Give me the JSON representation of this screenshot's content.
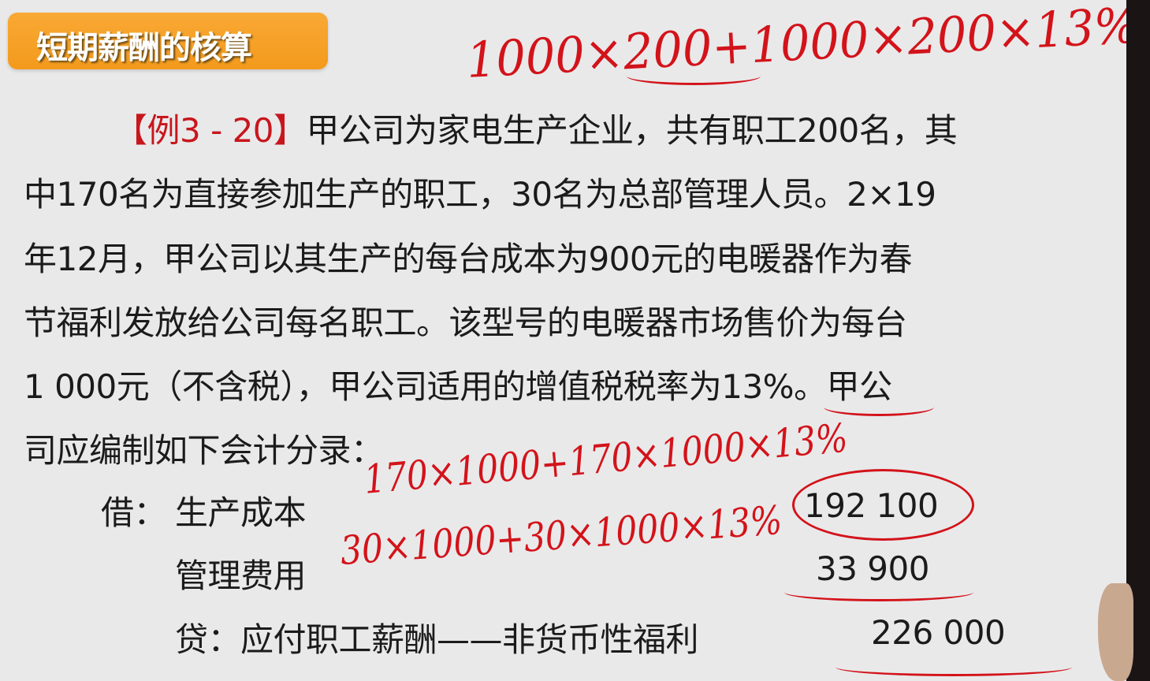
{
  "title": "短期薪酬的核算",
  "example_tag": "【例3 - 20】",
  "paragraph": [
    "甲公司为家电生产企业，共有职工200名，其",
    "中170名为直接参加生产的职工，30名为总部管理人员。2×19",
    "年12月，甲公司以其生产的每台成本为900元的电暖器作为春",
    "节福利发放给公司每名职工。该型号的电暖器市场售价为每台",
    "1 000元（不含税），甲公司适用的增值税税率为13%。甲公",
    "司应编制如下会计分录："
  ],
  "entries": [
    {
      "side": "借：",
      "account": "生产成本",
      "amount": "192 100"
    },
    {
      "side": "",
      "account": "管理费用",
      "amount": "33 900"
    },
    {
      "side": "贷：",
      "account": "应付职工薪酬——非货币性福利",
      "amount": "226 000"
    }
  ],
  "annotations": {
    "top": "1000×200+1000×200×13%",
    "production": "170×1000+170×1000×13%",
    "management": "30×1000+30×1000×13%"
  },
  "colors": {
    "accent": "#f39a1c",
    "red": "#c8161d",
    "ink": "#d3131a"
  }
}
